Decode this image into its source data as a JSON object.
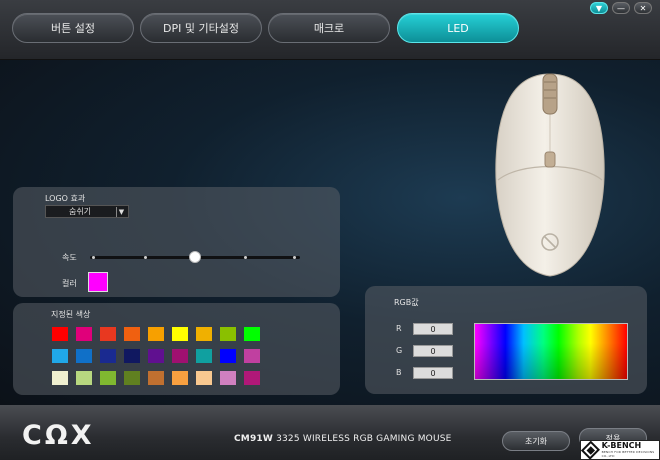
{
  "window_controls": {
    "menu": "▼",
    "minimize": "—",
    "close": "✕"
  },
  "tabs": [
    {
      "label": "버튼 설정",
      "active": false
    },
    {
      "label": "DPI 및 기타설정",
      "active": false
    },
    {
      "label": "매크로",
      "active": false
    },
    {
      "label": "LED",
      "active": true
    }
  ],
  "logo_panel": {
    "title": "LOGO 효과",
    "effect_value": "숨쉬기",
    "speed_label": "속도",
    "speed_level": 0.5,
    "color_label": "컬러",
    "color_value": "#ff00ff"
  },
  "presets": {
    "title": "지정된 색상",
    "colors": [
      [
        "#ff0000",
        "#e0007a",
        "#e83820",
        "#f06010",
        "#f7a000",
        "#ffff00",
        "#f0b000",
        "#8ac000",
        "#00ff00"
      ],
      [
        "#20a8e8",
        "#1070c8",
        "#1a2a90",
        "#101860",
        "#601090",
        "#a01070",
        "#10a0a0",
        "#0000ff",
        "#c040a0"
      ],
      [
        "#f0f0d0",
        "#b8d880",
        "#80b830",
        "#608020",
        "#c07030",
        "#f8a040",
        "#f8c890",
        "#d080c0",
        "#b01878"
      ]
    ]
  },
  "rgb_panel": {
    "title": "RGB값",
    "r_label": "R",
    "g_label": "G",
    "b_label": "B",
    "r_value": "0",
    "g_value": "0",
    "b_value": "0"
  },
  "footer": {
    "logo": "CΩX",
    "model_bold": "CM91W",
    "model_rest": " 3325 WIRELESS RGB GAMING MOUSE",
    "reset_label": "초기화",
    "save_label": "적용"
  },
  "watermark": {
    "text": "K-BENCH",
    "sub": "BENCH FOR BETTER DECISIONS CO.,LTD"
  },
  "colors": {
    "accent": "#1ab8c0",
    "panel": "#5a5f66"
  }
}
